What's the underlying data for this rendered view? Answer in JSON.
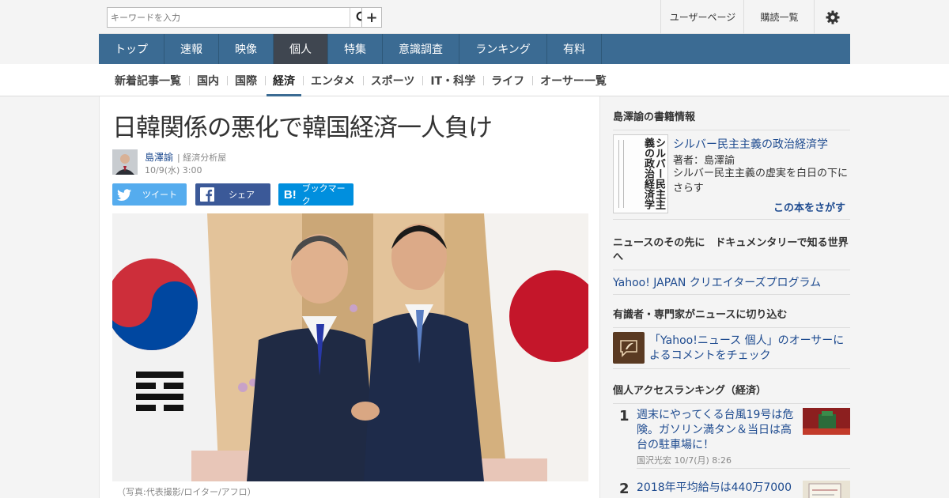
{
  "header": {
    "search_placeholder": "キーワードを入力",
    "user_page": "ユーザーページ",
    "subscriptions": "購読一覧"
  },
  "main_nav": [
    "トップ",
    "速報",
    "映像",
    "個人",
    "特集",
    "意識調査",
    "ランキング",
    "有料"
  ],
  "sub_nav": [
    "新着記事一覧",
    "国内",
    "国際",
    "経済",
    "エンタメ",
    "スポーツ",
    "IT・科学",
    "ライフ",
    "オーサー一覧"
  ],
  "article": {
    "title": "日韓関係の悪化で韓国経済一人負け",
    "author": "島澤諭",
    "author_role": "| 経済分析屋",
    "date": "10/9(水) 3:00",
    "share_tweet": "ツイート",
    "share_facebook": "シェア",
    "share_bookmark": "ブックマーク",
    "photo_caption": "（写真:代表撮影/ロイター/アフロ）"
  },
  "sidebar": {
    "book_section_title": "島澤諭の書籍情報",
    "book_cover_text": "シルバー民主主義の政治経済学",
    "book_title": "シルバー民主主義の政治経済学",
    "book_author": "著者：島澤諭",
    "book_desc": "シルバー民主主義の虚実を白日の下にさらす",
    "book_cta": "この本をさがす",
    "doc_section_title": "ニュースのその先に　ドキュメンタリーで知る世界へ",
    "doc_link": "Yahoo! JAPAN クリエイターズプログラム",
    "expert_section_title": "有識者・専門家がニュースに切り込む",
    "expert_link": "「Yahoo!ニュース 個人」のオーサーによるコメントをチェック",
    "ranking_section_title": "個人アクセスランキング（経済）",
    "ranking": [
      {
        "rank": "1",
        "title": "週末にやってくる台風19号は危険。ガソリン満タン＆当日は高台の駐車場に！",
        "meta": "国沢光宏 10/7(月) 8:26"
      },
      {
        "rank": "2",
        "title": "2018年平均給与は440万7000",
        "meta": ""
      }
    ]
  }
}
